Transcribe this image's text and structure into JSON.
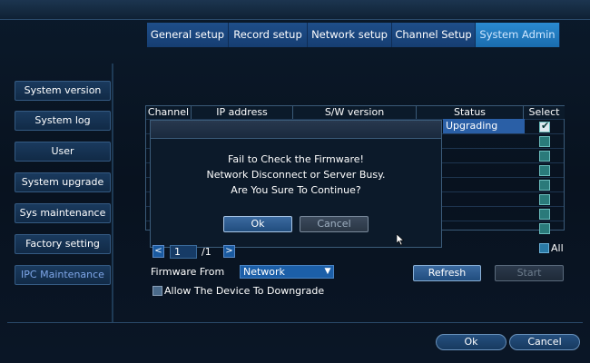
{
  "tabs": [
    {
      "label": "General setup"
    },
    {
      "label": "Record setup"
    },
    {
      "label": "Network setup"
    },
    {
      "label": "Channel Setup"
    },
    {
      "label": "System Admin"
    }
  ],
  "active_tab": "System Admin",
  "sidebar": {
    "items": [
      {
        "label": "System version"
      },
      {
        "label": "System log"
      },
      {
        "label": "User"
      },
      {
        "label": "System upgrade"
      },
      {
        "label": "Sys maintenance"
      },
      {
        "label": "Factory setting"
      },
      {
        "label": "IPC Maintenance"
      }
    ],
    "active": "IPC Maintenance"
  },
  "table": {
    "columns": [
      "Channel",
      "IP address",
      "S/W version",
      "Status",
      "Select"
    ],
    "rows": [
      {
        "status": "Upgrading",
        "selected": true
      },
      {
        "status": "",
        "selected": false
      },
      {
        "status": "",
        "selected": false
      },
      {
        "status": "",
        "selected": false
      },
      {
        "status": "",
        "selected": false
      },
      {
        "status": "",
        "selected": false
      },
      {
        "status": "",
        "selected": false
      },
      {
        "status": "",
        "selected": false
      }
    ]
  },
  "dialog": {
    "lines": [
      "Fail to Check the Firmware!",
      "Network Disconnect or Server Busy.",
      "Are You Sure To Continue?"
    ],
    "ok_label": "Ok",
    "cancel_label": "Cancel"
  },
  "pager": {
    "prev": "<",
    "next": ">",
    "page": "1",
    "total": "/1"
  },
  "all_label": "All",
  "firmware": {
    "label": "Firmware From",
    "value": "Network"
  },
  "refresh_label": "Refresh",
  "start_label": "Start",
  "downgrade_label": "Allow The Device To Downgrade",
  "bottom": {
    "ok_label": "Ok",
    "cancel_label": "Cancel"
  },
  "colors": {
    "accent": "#2a8ad0",
    "status_highlight": "#2a5fa6",
    "tab_bg": "#1e4e8a"
  }
}
